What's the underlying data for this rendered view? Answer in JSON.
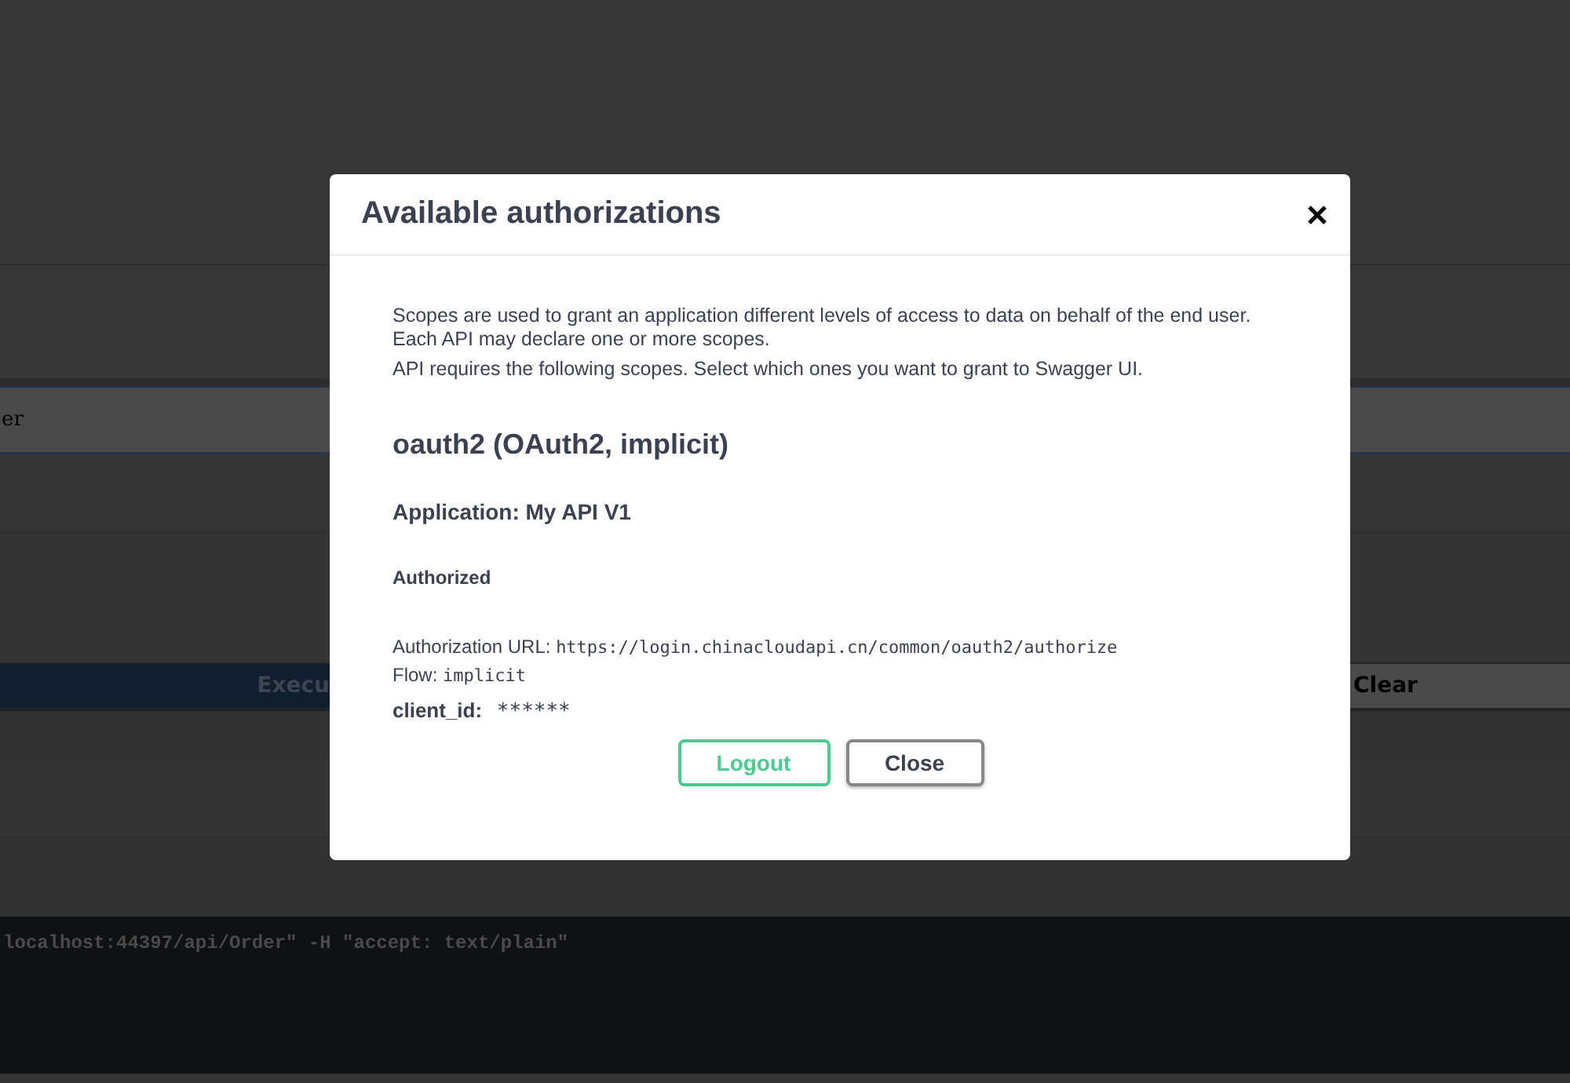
{
  "background": {
    "input_text": "er",
    "execute_button": "Execu",
    "clear_button": "Clear",
    "curl_command": "localhost:44397/api/Order\" -H \"accept: text/plain\""
  },
  "dialog": {
    "title": "Available authorizations",
    "description": [
      "Scopes are used to grant an application different levels of access to data on behalf of the end user. Each API may declare one or more scopes.",
      "API requires the following scopes. Select which ones you want to grant to Swagger UI."
    ],
    "scheme_title": "oauth2 (OAuth2, implicit)",
    "application": "Application: My API V1",
    "status": "Authorized",
    "url_label": "Authorization URL:",
    "url": "https://login.chinacloudapi.cn/common/oauth2/authorize",
    "flow_label": "Flow:",
    "flow": "implicit",
    "client_id_label": "client_id:",
    "client_id": "******",
    "buttons": [
      {
        "label": "Logout",
        "kind": "primary"
      },
      {
        "label": "Close",
        "kind": "secondary"
      }
    ]
  }
}
